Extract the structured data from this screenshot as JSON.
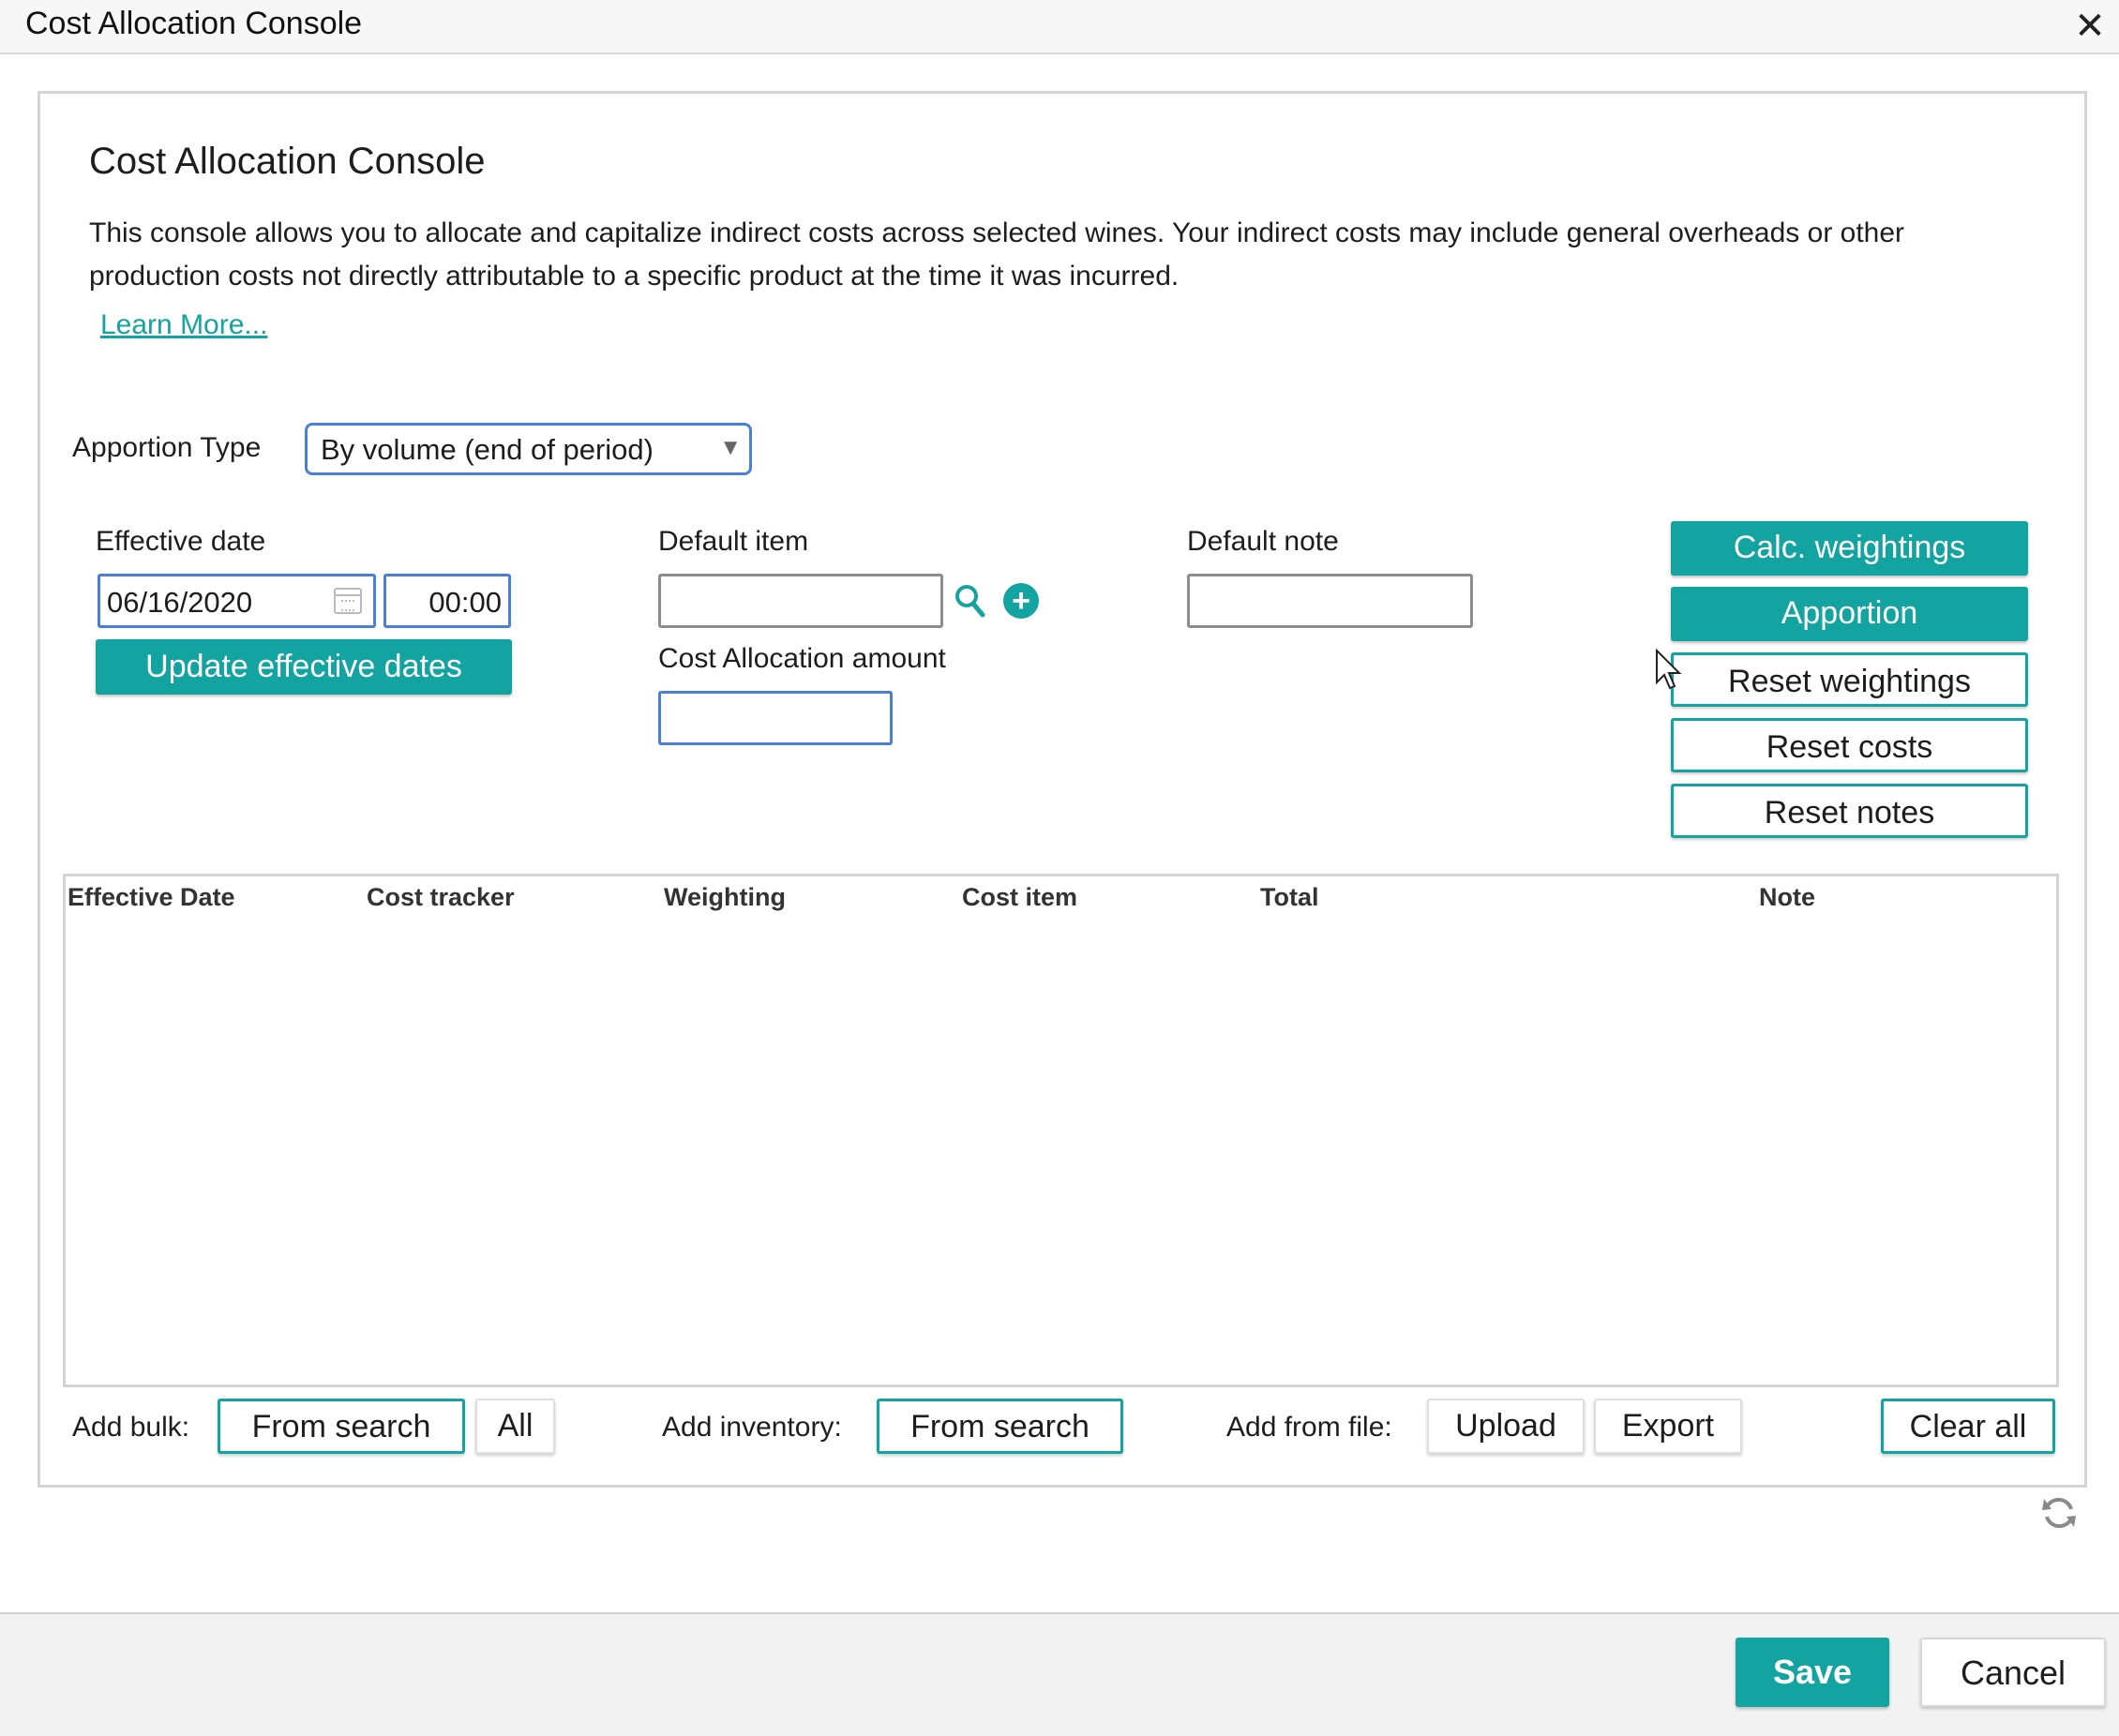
{
  "window": {
    "title": "Cost Allocation Console",
    "close_icon": "close-icon"
  },
  "header": {
    "title": "Cost Allocation Console",
    "description": "This console allows you to allocate and capitalize indirect costs across selected wines. Your indirect costs may include general overheads or other production costs not directly attributable to a specific product at the time it was incurred.",
    "learn_more": "Learn More..."
  },
  "apportion": {
    "label": "Apportion Type",
    "selected": "By volume (end of period)",
    "arrow": "▼"
  },
  "effective_date": {
    "label": "Effective date",
    "date_value": "06/16/2020",
    "time_value": "00:00",
    "update_button": "Update effective dates"
  },
  "default_item": {
    "label": "Default item",
    "value": ""
  },
  "cost_allocation": {
    "label": "Cost Allocation amount",
    "value": ""
  },
  "default_note": {
    "label": "Default note",
    "value": ""
  },
  "actions": {
    "calc_weightings": "Calc. weightings",
    "apportion": "Apportion",
    "reset_weightings": "Reset weightings",
    "reset_costs": "Reset costs",
    "reset_notes": "Reset notes"
  },
  "table": {
    "columns": [
      "Effective Date",
      "Cost tracker",
      "Weighting",
      "Cost item",
      "Total",
      "Note"
    ],
    "rows": []
  },
  "toolbar": {
    "add_bulk_label": "Add bulk:",
    "bulk_from_search": "From search",
    "bulk_all": "All",
    "add_inventory_label": "Add inventory:",
    "inventory_from_search": "From search",
    "add_from_file_label": "Add from file:",
    "upload": "Upload",
    "export": "Export",
    "clear_all": "Clear all"
  },
  "footer": {
    "save": "Save",
    "cancel": "Cancel"
  },
  "colors": {
    "accent": "#13a3a0",
    "focus_border": "#4a7fd6"
  }
}
